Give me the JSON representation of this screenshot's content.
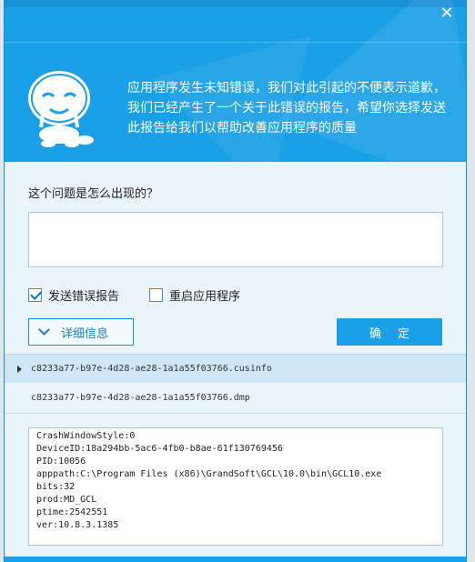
{
  "header": {
    "message": "应用程序发生未知错误，我们对此引起的不便表示道歉，我们已经产生了一个关于此错误的报告，希望你选择发送此报告给我们以帮助改善应用程序的质量",
    "close_glyph": "✕"
  },
  "form": {
    "question_label": "这个问题是怎么出现的？",
    "description_value": "",
    "send_report": {
      "label": "发送错误报告",
      "checked": true
    },
    "restart_app": {
      "label": "重启应用程序",
      "checked": false
    },
    "details_label": "详细信息",
    "ok_label": "确定"
  },
  "files": [
    {
      "name": "c8233a77-b97e-4d28-ae28-1a1a55f03766.cusinfo",
      "selected": true
    },
    {
      "name": "c8233a77-b97e-4d28-ae28-1a1a55f03766.dmp",
      "selected": false
    }
  ],
  "log_lines": [
    "CrashWindowStyle:0",
    "DeviceID:18a294bb-5ac6-4fb0-b8ae-61f130769456",
    "PID:10056",
    "apppath:C:\\Program Files (x86)\\GrandSoft\\GCL\\10.0\\bin\\GCL10.exe",
    "bits:32",
    "prod:MD_GCL",
    "ptime:2542551",
    "ver:10.8.3.1385"
  ],
  "colors": {
    "header_blue": "#1aa0e6",
    "accent": "#1b8fd6",
    "panel_bg": "#eaf4fb"
  }
}
